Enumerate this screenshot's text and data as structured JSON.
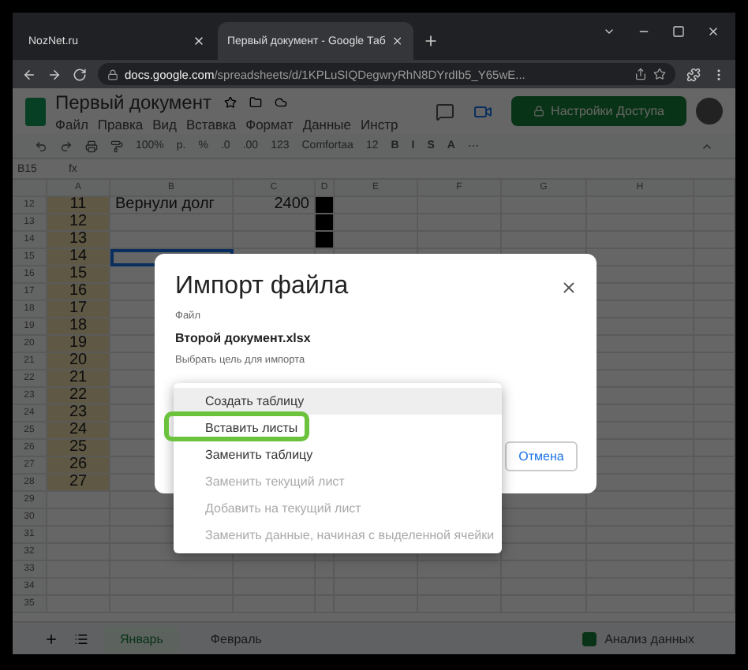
{
  "browser": {
    "tabs": [
      {
        "title": "NozNet.ru",
        "selected": false
      },
      {
        "title": "Первый документ - Google Таб",
        "selected": true
      }
    ],
    "url_host": "docs.google.com",
    "url_path": "/spreadsheets/d/1KPLuSIQDegwryRhN8DYrdIb5_Y65wE..."
  },
  "doc": {
    "title": "Первый документ",
    "menu": [
      "Файл",
      "Правка",
      "Вид",
      "Вставка",
      "Формат",
      "Данные",
      "Инстр"
    ],
    "share_button": "Настройки Доступа"
  },
  "toolbar": {
    "zoom": "100%",
    "number_formats": [
      "р.",
      "%",
      ".0",
      ".00",
      "123"
    ],
    "font": "Comfortaa",
    "font_size": "12",
    "text_formats": [
      "B",
      "I",
      "S",
      "A"
    ],
    "more": "⋯"
  },
  "formula_bar": {
    "cell_ref": "B15",
    "fx": "fx"
  },
  "sheet": {
    "columns": [
      "A",
      "B",
      "C",
      "D",
      "E",
      "F",
      "G",
      "H"
    ],
    "rows": [
      {
        "number": "12",
        "a": "11",
        "b": "Вернули долг",
        "c": "2400",
        "d_filled": true,
        "selected": false
      },
      {
        "number": "13",
        "a": "12",
        "d_filled": true,
        "selected": false
      },
      {
        "number": "14",
        "a": "13",
        "d_filled": true,
        "selected": false
      },
      {
        "number": "15",
        "a": "14",
        "d_filled": false,
        "selected": true
      },
      {
        "number": "16",
        "a": "15",
        "selected": false
      },
      {
        "number": "17",
        "a": "16",
        "selected": false
      },
      {
        "number": "18",
        "a": "17",
        "selected": false
      },
      {
        "number": "19",
        "a": "18",
        "selected": false
      },
      {
        "number": "20",
        "a": "19",
        "selected": false
      },
      {
        "number": "21",
        "a": "20",
        "selected": false
      },
      {
        "number": "22",
        "a": "21",
        "selected": false
      },
      {
        "number": "23",
        "a": "22",
        "selected": false
      },
      {
        "number": "24",
        "a": "23",
        "selected": false
      },
      {
        "number": "25",
        "a": "24",
        "selected": false
      },
      {
        "number": "26",
        "a": "25",
        "selected": false
      },
      {
        "number": "27",
        "a": "26",
        "selected": false
      },
      {
        "number": "28",
        "a": "27",
        "selected": false
      },
      {
        "number": "29",
        "selected": false
      },
      {
        "number": "30",
        "selected": false
      },
      {
        "number": "31",
        "selected": false
      },
      {
        "number": "32",
        "d_filled": false,
        "selected": false
      },
      {
        "number": "33",
        "d_filled": false,
        "selected": false
      },
      {
        "number": "34",
        "d_filled": false,
        "selected": false
      },
      {
        "number": "35",
        "d_filled": false,
        "selected": false
      }
    ]
  },
  "sheet_tabs": [
    {
      "label": "Январь",
      "selected": true
    },
    {
      "label": "Февраль",
      "selected": false
    }
  ],
  "explore_button": "Анализ данных",
  "dialog": {
    "title": "Импорт файла",
    "file_label": "Файл",
    "file_name": "Второй документ.xlsx",
    "target_label": "Выбрать цель для импорта",
    "cancel_button": "Отмена",
    "options": [
      {
        "label": "Создать таблицу",
        "selected": true,
        "disabled": false,
        "annotated": false
      },
      {
        "label": "Вставить листы",
        "selected": false,
        "disabled": false,
        "annotated": true
      },
      {
        "label": "Заменить таблицу",
        "selected": false,
        "disabled": false,
        "annotated": false
      },
      {
        "label": "Заменить текущий лист",
        "selected": false,
        "disabled": true,
        "annotated": false
      },
      {
        "label": "Добавить на текущий лист",
        "selected": false,
        "disabled": true,
        "annotated": false
      },
      {
        "label": "Заменить данные, начиная с выделенной ячейки",
        "selected": false,
        "disabled": true,
        "annotated": false
      }
    ]
  }
}
